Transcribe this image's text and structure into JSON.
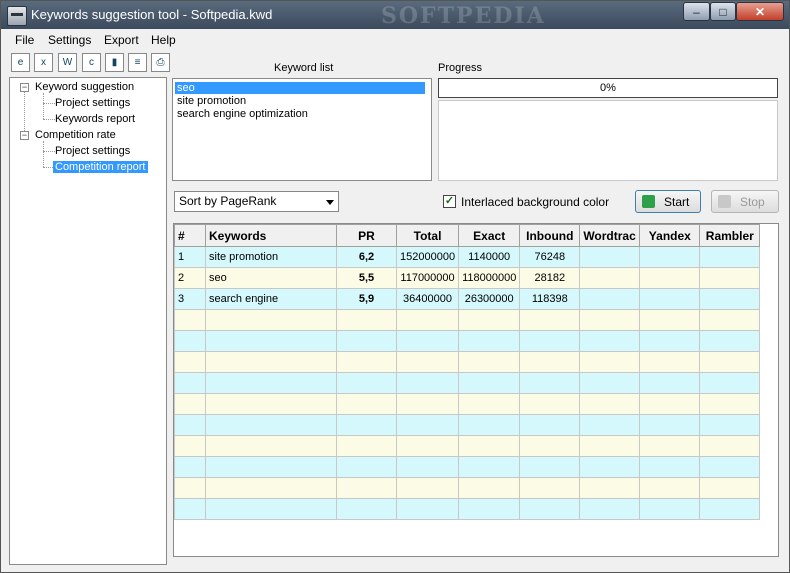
{
  "window": {
    "title": "Keywords suggestion tool - Softpedia.kwd",
    "watermark": "SOFTPEDIA",
    "min_label": "–",
    "max_label": "□",
    "close_label": "✕"
  },
  "menu": [
    "File",
    "Settings",
    "Export",
    "Help"
  ],
  "toolbar": [
    {
      "icon": "export-html-icon",
      "glyph": "e"
    },
    {
      "icon": "export-excel-icon",
      "glyph": "x"
    },
    {
      "icon": "export-word-icon",
      "glyph": "W"
    },
    {
      "icon": "export-csv-icon",
      "glyph": "c"
    },
    {
      "icon": "copy-icon",
      "glyph": "▮"
    },
    {
      "icon": "report-icon",
      "glyph": "≡"
    },
    {
      "icon": "print-icon",
      "glyph": "⎙"
    }
  ],
  "tree": {
    "keyword_suggestion": "Keyword suggestion",
    "ks_project_settings": "Project settings",
    "ks_keywords_report": "Keywords report",
    "competition_rate": "Competition rate",
    "cr_project_settings": "Project settings",
    "cr_competition_report": "Competition report"
  },
  "keyword_list": {
    "label": "Keyword list",
    "items": [
      "seo",
      "site promotion",
      "search engine optimization"
    ]
  },
  "progress": {
    "label": "Progress",
    "value": "0%"
  },
  "sort": {
    "selected": "Sort by PageRank"
  },
  "interlaced": {
    "label": "Interlaced background color",
    "checked": true
  },
  "buttons": {
    "start": "Start",
    "stop": "Stop"
  },
  "grid": {
    "columns": [
      "#",
      "Keywords",
      "PR",
      "Total",
      "Exact",
      "Inbound",
      "Wordtrac",
      "Yandex",
      "Rambler"
    ],
    "rows": [
      [
        "1",
        "site promotion",
        "6,2",
        "152000000",
        "1140000",
        "76248",
        "",
        "",
        ""
      ],
      [
        "2",
        "seo",
        "5,5",
        "117000000",
        "118000000",
        "28182",
        "",
        "",
        ""
      ],
      [
        "3",
        "search engine",
        "5,9",
        "36400000",
        "26300000",
        "118398",
        "",
        "",
        ""
      ]
    ],
    "empty_rows": 10
  }
}
